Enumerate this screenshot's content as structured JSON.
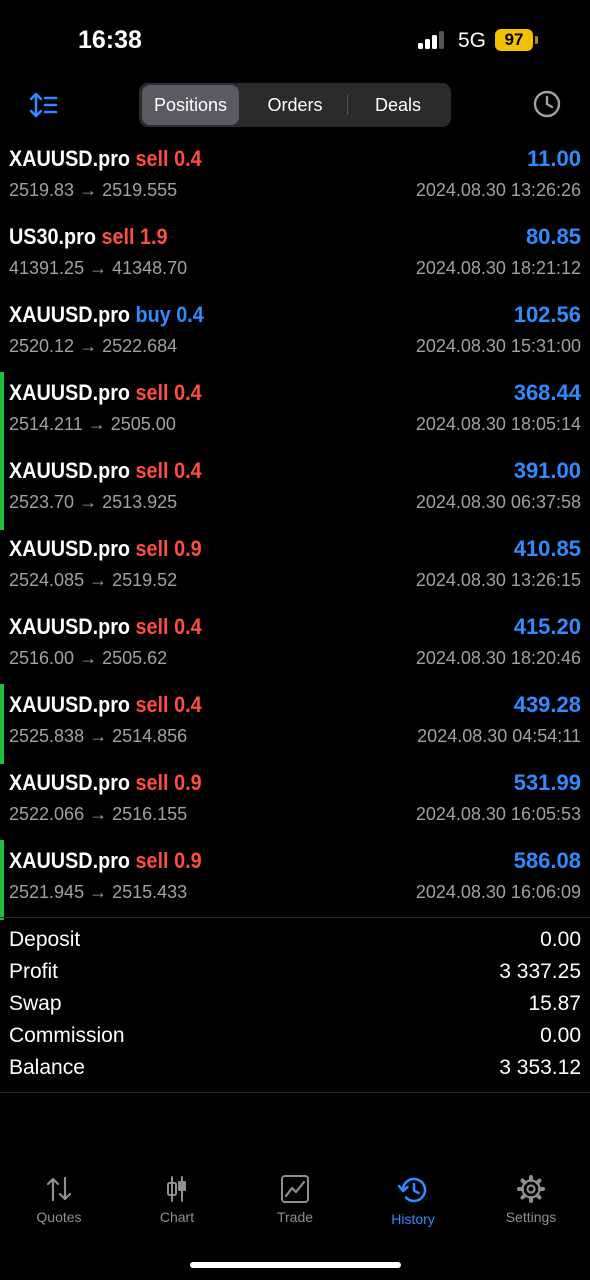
{
  "status_bar": {
    "time": "16:38",
    "network": "5G",
    "battery": "97"
  },
  "toolbar": {
    "sort_icon": "sort-icon",
    "tabs": [
      {
        "label": "Positions"
      },
      {
        "label": "Orders"
      },
      {
        "label": "Deals"
      }
    ],
    "history_icon": "clock-icon"
  },
  "deals": [
    {
      "symbol": "XAUUSD.pro",
      "side": "sell",
      "volume": "0.4",
      "profit": "11.00",
      "open": "2519.83",
      "close": "2519.555",
      "time": "2024.08.30 13:26:26"
    },
    {
      "symbol": "US30.pro",
      "side": "sell",
      "volume": "1.9",
      "profit": "80.85",
      "open": "41391.25",
      "close": "41348.70",
      "time": "2024.08.30 18:21:12"
    },
    {
      "symbol": "XAUUSD.pro",
      "side": "buy",
      "volume": "0.4",
      "profit": "102.56",
      "open": "2520.12",
      "close": "2522.684",
      "time": "2024.08.30 15:31:00"
    },
    {
      "symbol": "XAUUSD.pro",
      "side": "sell",
      "volume": "0.4",
      "profit": "368.44",
      "open": "2514.211",
      "close": "2505.00",
      "time": "2024.08.30 18:05:14"
    },
    {
      "symbol": "XAUUSD.pro",
      "side": "sell",
      "volume": "0.4",
      "profit": "391.00",
      "open": "2523.70",
      "close": "2513.925",
      "time": "2024.08.30 06:37:58"
    },
    {
      "symbol": "XAUUSD.pro",
      "side": "sell",
      "volume": "0.9",
      "profit": "410.85",
      "open": "2524.085",
      "close": "2519.52",
      "time": "2024.08.30 13:26:15"
    },
    {
      "symbol": "XAUUSD.pro",
      "side": "sell",
      "volume": "0.4",
      "profit": "415.20",
      "open": "2516.00",
      "close": "2505.62",
      "time": "2024.08.30 18:20:46"
    },
    {
      "symbol": "XAUUSD.pro",
      "side": "sell",
      "volume": "0.4",
      "profit": "439.28",
      "open": "2525.838",
      "close": "2514.856",
      "time": "2024.08.30 04:54:11"
    },
    {
      "symbol": "XAUUSD.pro",
      "side": "sell",
      "volume": "0.9",
      "profit": "531.99",
      "open": "2522.066",
      "close": "2516.155",
      "time": "2024.08.30 16:05:53"
    },
    {
      "symbol": "XAUUSD.pro",
      "side": "sell",
      "volume": "0.9",
      "profit": "586.08",
      "open": "2521.945",
      "close": "2515.433",
      "time": "2024.08.30 16:06:09"
    }
  ],
  "summary": [
    {
      "label": "Deposit",
      "value": "0.00"
    },
    {
      "label": "Profit",
      "value": "3 337.25"
    },
    {
      "label": "Swap",
      "value": "15.87"
    },
    {
      "label": "Commission",
      "value": "0.00"
    },
    {
      "label": "Balance",
      "value": "3 353.12"
    }
  ],
  "tabbar": [
    {
      "label": "Quotes",
      "icon": "arrows-updown-icon"
    },
    {
      "label": "Chart",
      "icon": "candlestick-icon"
    },
    {
      "label": "Trade",
      "icon": "line-chart-icon"
    },
    {
      "label": "History",
      "icon": "history-icon"
    },
    {
      "label": "Settings",
      "icon": "gear-icon"
    }
  ],
  "colors": {
    "sell": "#ff4d3f",
    "buy": "#2f8bff",
    "profit": "#2f8bff",
    "marker": "#1fbf3a",
    "active_tab": "#2f8bff",
    "battery": "#f2c200"
  }
}
